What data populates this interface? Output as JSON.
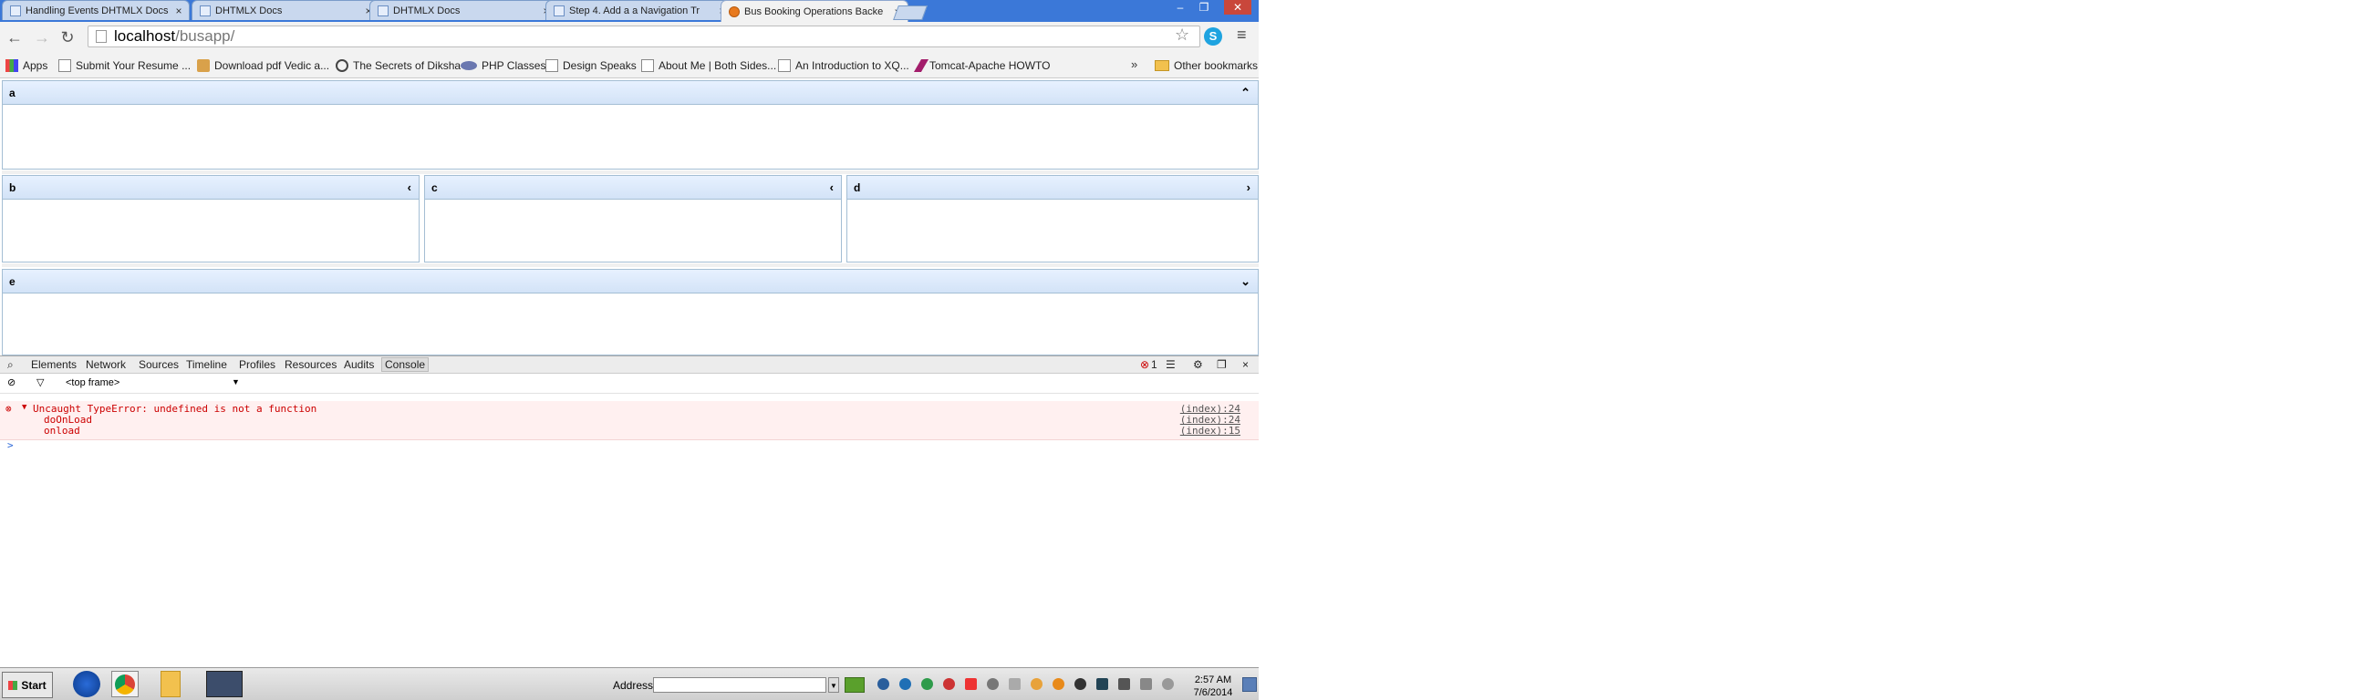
{
  "browser": {
    "tabs": [
      {
        "title": "Handling Events DHTMLX Docs",
        "active": false
      },
      {
        "title": "DHTMLX Docs",
        "active": false
      },
      {
        "title": "DHTMLX Docs",
        "active": false
      },
      {
        "title": "Step 4. Add a a Navigation Tr",
        "active": false
      },
      {
        "title": "Bus Booking Operations Backe",
        "active": true
      }
    ],
    "url_host": "localhost",
    "url_path": "/busapp/",
    "bookmarks": [
      {
        "label": "Apps",
        "icon": "apps-grid-icon"
      },
      {
        "label": "Submit Your Resume ...",
        "icon": "page-icon"
      },
      {
        "label": "Download pdf Vedic a...",
        "icon": "download-icon"
      },
      {
        "label": "The Secrets of Diksha",
        "icon": "secret-icon"
      },
      {
        "label": "PHP Classes",
        "icon": "php-icon"
      },
      {
        "label": "Design Speaks",
        "icon": "page-icon"
      },
      {
        "label": "About Me | Both Sides...",
        "icon": "page-icon"
      },
      {
        "label": "An Introduction to XQ...",
        "icon": "page-icon"
      },
      {
        "label": "Tomcat-Apache HOWTO",
        "icon": "feather-icon"
      }
    ],
    "bookmarks_overflow": "»",
    "other_bookmarks": "Other bookmarks"
  },
  "layout": {
    "cell_a": "a",
    "cell_b": "b",
    "cell_c": "c",
    "cell_d": "d",
    "cell_e": "e"
  },
  "devtools": {
    "tabs": [
      "Elements",
      "Network",
      "Sources",
      "Timeline",
      "Profiles",
      "Resources",
      "Audits",
      "Console"
    ],
    "active_tab": "Console",
    "error_count": "1",
    "frame": "<top frame>",
    "error": {
      "message": "Uncaught TypeError: undefined is not a function",
      "stack": [
        "doOnLoad",
        "onload"
      ],
      "locations": [
        "(index):24",
        "(index):24",
        "(index):15"
      ]
    },
    "prompt": ">"
  },
  "taskbar": {
    "start": "Start",
    "address_label": "Address",
    "time": "2:57 AM",
    "date": "7/6/2014"
  }
}
